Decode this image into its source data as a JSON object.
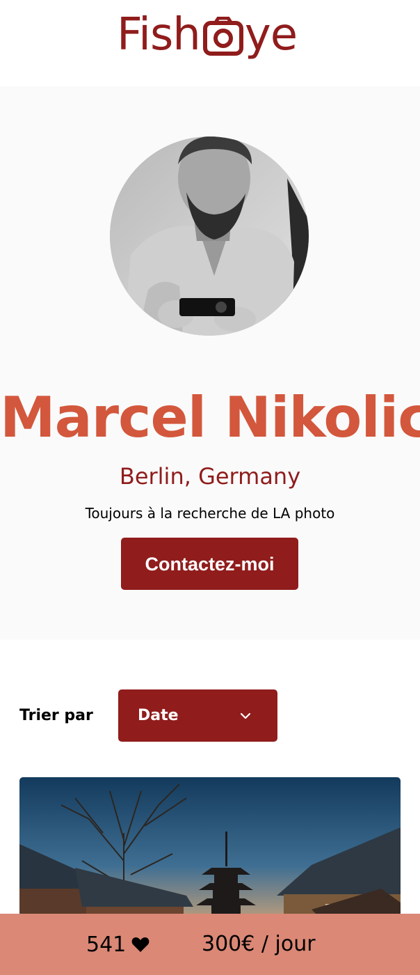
{
  "header": {
    "logo_part1": "Fish",
    "logo_part2": "ye",
    "logo_icon": "camera-icon",
    "brand_color": "#901c1c"
  },
  "photographer": {
    "name": "Marcel Nikolic",
    "location": "Berlin, Germany",
    "tagline": "Toujours à la recherche de LA photo",
    "contact_label": "Contactez-moi",
    "name_color": "#d3573c"
  },
  "sort": {
    "label": "Trier par",
    "selected": "Date",
    "icon": "chevron-down-icon"
  },
  "footer": {
    "likes": "541",
    "like_icon": "heart-icon",
    "price": "300€ / jour",
    "background": "#db8876"
  }
}
